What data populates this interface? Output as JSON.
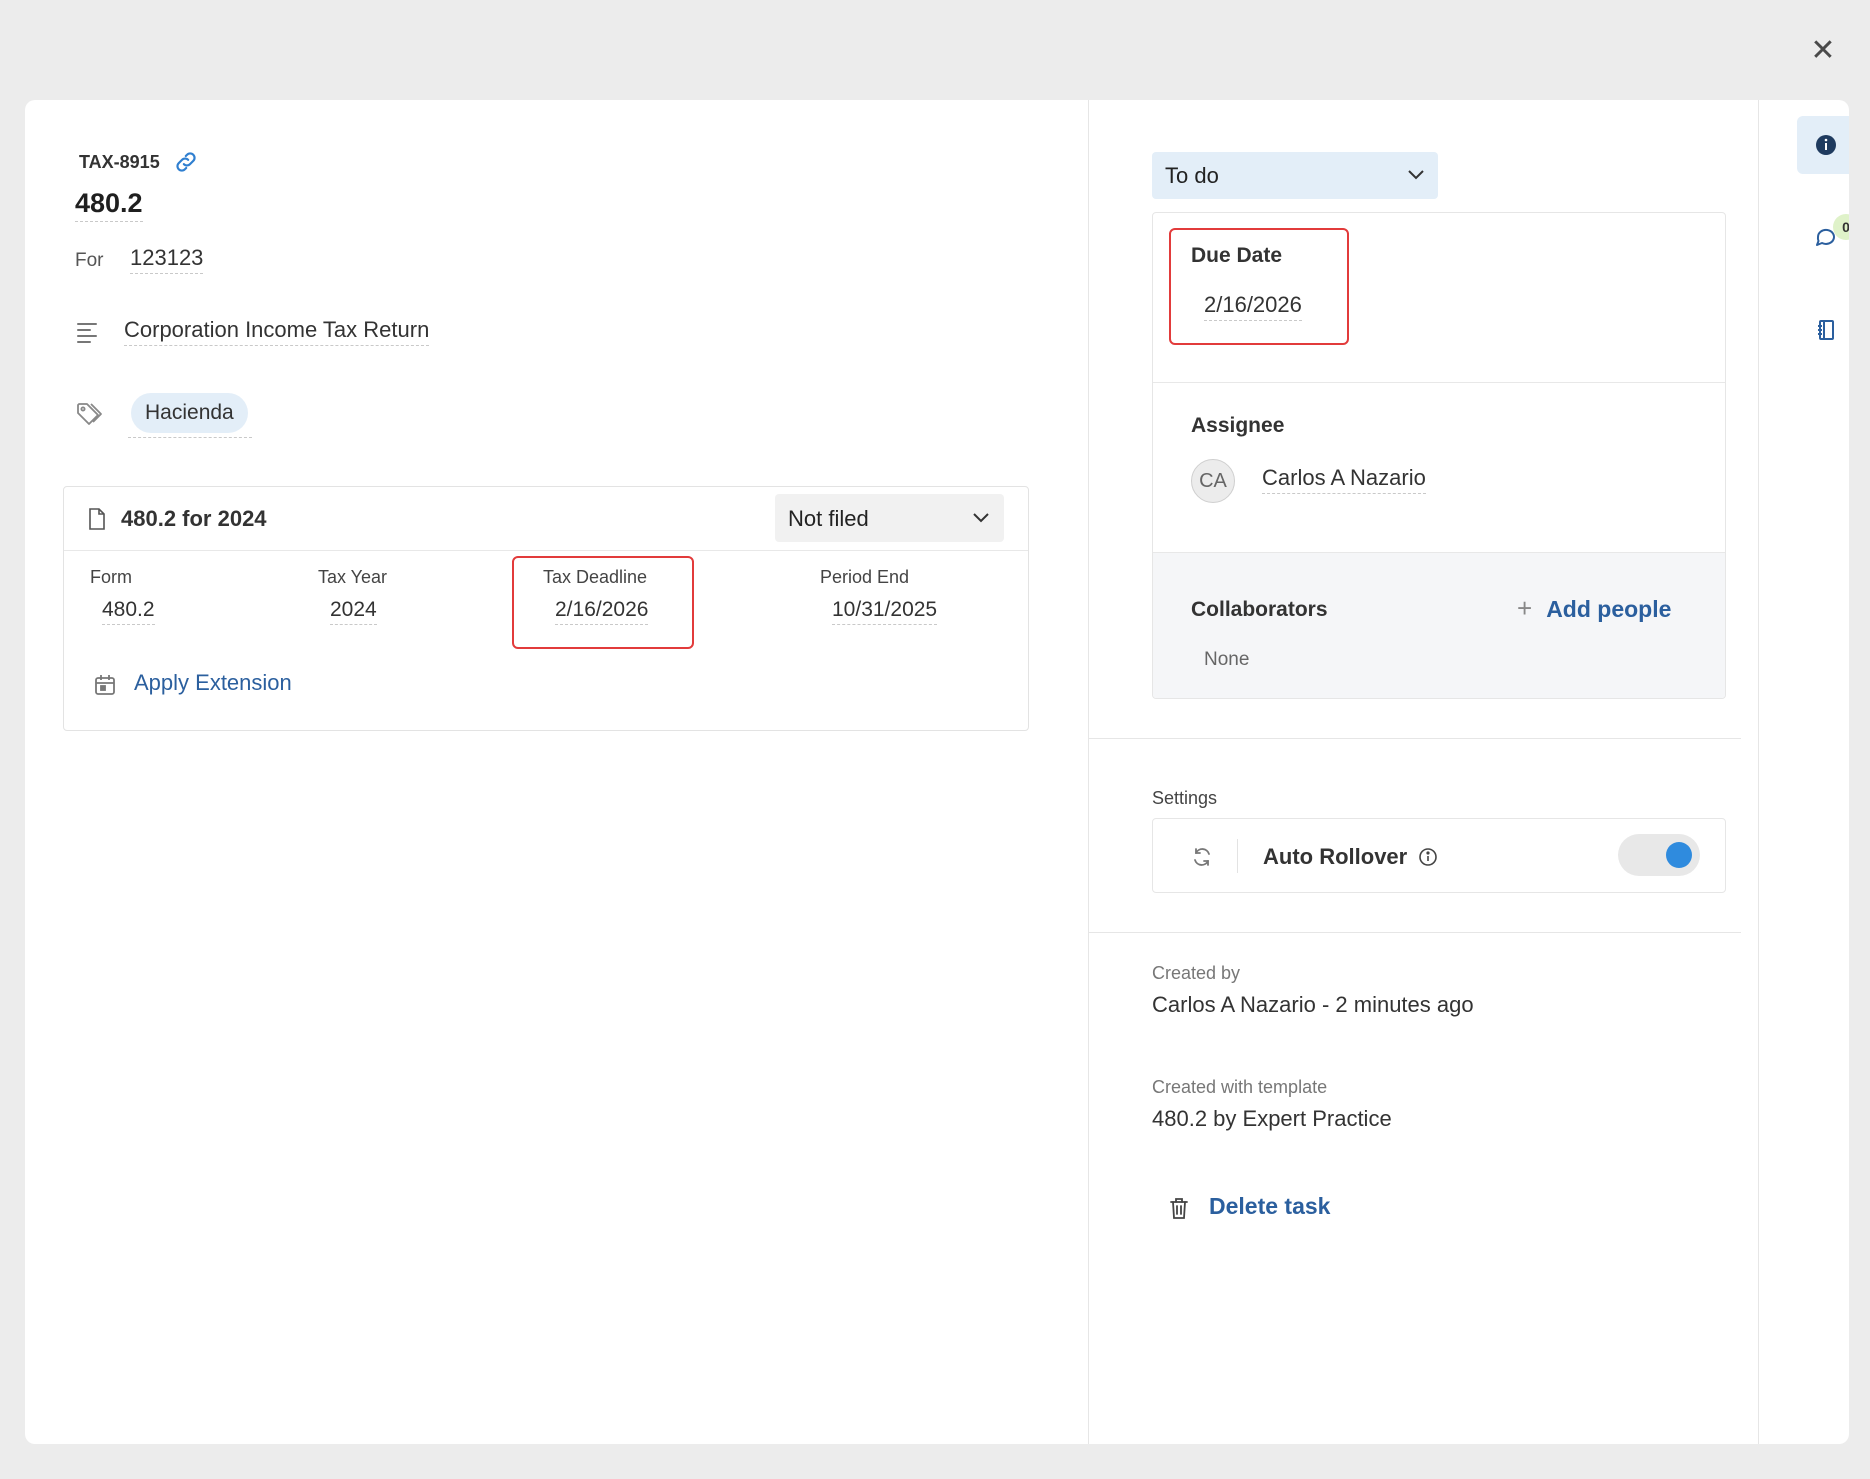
{
  "window": {
    "close_glyph": "✕"
  },
  "task": {
    "id": "TAX-8915",
    "title": "480.2",
    "for_label": "For",
    "for_value": "123123",
    "description": "Corporation Income Tax Return",
    "tags": [
      "Hacienda"
    ]
  },
  "filing": {
    "title": "480.2 for 2024",
    "status": "Not filed",
    "fields": [
      {
        "label": "Form",
        "value": "480.2"
      },
      {
        "label": "Tax Year",
        "value": "2024"
      },
      {
        "label": "Tax Deadline",
        "value": "2/16/2026"
      },
      {
        "label": "Period End",
        "value": "10/31/2025"
      }
    ],
    "extension_label": "Apply Extension"
  },
  "details": {
    "status": "To do",
    "due_date_label": "Due Date",
    "due_date": "2/16/2026",
    "assignee_label": "Assignee",
    "assignee_initials": "CA",
    "assignee_name": "Carlos A Nazario",
    "collaborators_label": "Collaborators",
    "add_people_label": "Add people",
    "collaborators_none": "None"
  },
  "settings": {
    "label": "Settings",
    "auto_rollover_label": "Auto Rollover",
    "auto_rollover_on": true
  },
  "meta": {
    "created_by_label": "Created by",
    "created_by_value": "Carlos A Nazario - 2 minutes ago",
    "template_label": "Created with template",
    "template_value": "480.2 by Expert Practice",
    "delete_label": "Delete task"
  },
  "rail": {
    "comments_count": "0",
    "items": [
      "info-icon",
      "comment-icon",
      "activity-icon"
    ]
  },
  "colors": {
    "accent": "#2b5f9e",
    "highlight": "#e23b3b",
    "toggle_on": "#2f8bde",
    "select_bg": "#e3eef8"
  }
}
